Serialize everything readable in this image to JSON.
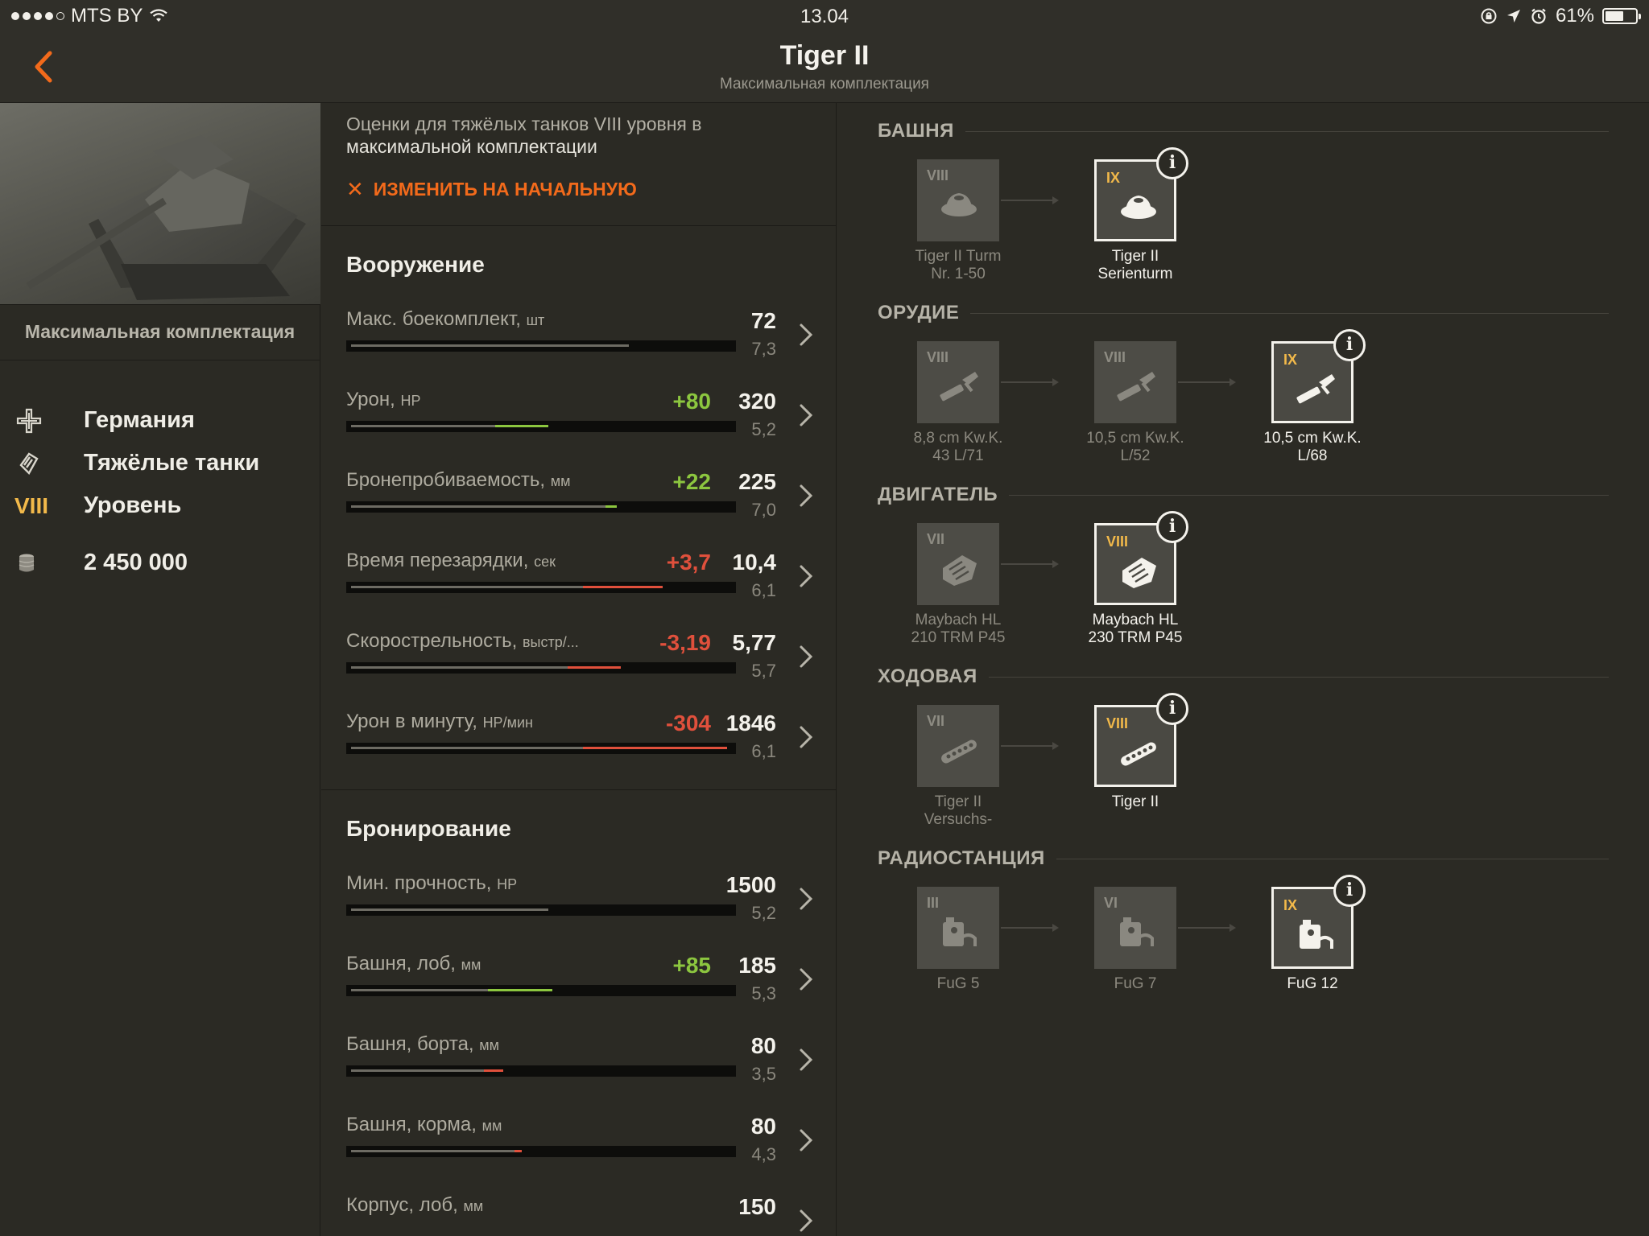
{
  "status": {
    "carrier": "MTS BY",
    "time": "13.04",
    "battery": "61%"
  },
  "nav": {
    "title": "Tiger II",
    "subtitle": "Максимальная комплектация"
  },
  "left": {
    "config_label": "Максимальная комплектация",
    "nation": "Германия",
    "type": "Тяжёлые танки",
    "tier_roman": "VIII",
    "tier_label": "Уровень",
    "price": "2 450 000"
  },
  "mid": {
    "desc_line1": "Оценки для тяжёлых танков VIII уровня в",
    "desc_line2": "максимальной комплектации",
    "reset_label": "ИЗМЕНИТЬ НА НАЧАЛЬНУЮ",
    "armament_title": "Вооружение",
    "armor_title": "Бронирование",
    "armament": [
      {
        "label": "Макс. боекомплект,",
        "unit": "шт",
        "delta": "",
        "value": "72",
        "score": "7,3",
        "base_fraction": 0.73,
        "chg_fraction": 0,
        "chg_color": "none"
      },
      {
        "label": "Урон,",
        "unit": "HP",
        "delta": "+80",
        "value": "320",
        "score": "5,2",
        "base_fraction": 0.38,
        "chg_fraction": 0.52,
        "chg_color": "#8cc63f"
      },
      {
        "label": "Бронепробиваемость,",
        "unit": "мм",
        "delta": "+22",
        "value": "225",
        "score": "7,0",
        "base_fraction": 0.67,
        "chg_fraction": 0.7,
        "chg_color": "#8cc63f"
      },
      {
        "label": "Время перезарядки,",
        "unit": "сек",
        "delta": "+3,7",
        "value": "10,4",
        "score": "6,1",
        "base_fraction": 0.61,
        "chg_fraction": 0.82,
        "chg_color": "#e0503c"
      },
      {
        "label": "Скорострельность,",
        "unit": "выстр/...",
        "delta": "-3,19",
        "value": "5,77",
        "score": "5,7",
        "base_fraction": 0.57,
        "chg_fraction": 0.71,
        "chg_color": "#e0503c"
      },
      {
        "label": "Урон в минуту,",
        "unit": "HP/мин",
        "delta": "-304",
        "value": "1846",
        "score": "6,1",
        "base_fraction": 0.61,
        "chg_fraction": 0.99,
        "chg_color": "#e0503c"
      }
    ],
    "armor": [
      {
        "label": "Мин. прочность,",
        "unit": "HP",
        "delta": "",
        "value": "1500",
        "score": "5,2",
        "base_fraction": 0.52,
        "chg_fraction": 0,
        "chg_color": "none"
      },
      {
        "label": "Башня, лоб,",
        "unit": "мм",
        "delta": "+85",
        "value": "185",
        "score": "5,3",
        "base_fraction": 0.36,
        "chg_fraction": 0.53,
        "chg_color": "#8cc63f"
      },
      {
        "label": "Башня, борта,",
        "unit": "мм",
        "delta": "",
        "value": "80",
        "score": "3,5",
        "base_fraction": 0.35,
        "chg_fraction": 0.4,
        "chg_color": "#e0503c"
      },
      {
        "label": "Башня, корма,",
        "unit": "мм",
        "delta": "",
        "value": "80",
        "score": "4,3",
        "base_fraction": 0.43,
        "chg_fraction": 0.45,
        "chg_color": "#e0503c"
      },
      {
        "label": "Корпус, лоб,",
        "unit": "мм",
        "delta": "",
        "value": "150",
        "score": "",
        "base_fraction": 0,
        "chg_fraction": 0,
        "chg_color": "none"
      }
    ]
  },
  "modules": [
    {
      "title": "БАШНЯ",
      "icon": "turret-icon",
      "items": [
        {
          "tier": "VIII",
          "name1": "Tiger II Turm",
          "name2": "Nr. 1-50",
          "active": false
        },
        {
          "tier": "IX",
          "name1": "Tiger II",
          "name2": "Serienturm",
          "active": true
        }
      ]
    },
    {
      "title": "ОРУДИЕ",
      "icon": "gun-icon",
      "items": [
        {
          "tier": "VIII",
          "name1": "8,8 cm Kw.K.",
          "name2": "43 L/71",
          "active": false
        },
        {
          "tier": "VIII",
          "name1": "10,5 cm Kw.K.",
          "name2": "L/52",
          "active": false
        },
        {
          "tier": "IX",
          "name1": "10,5 cm Kw.K.",
          "name2": "L/68",
          "active": true
        }
      ]
    },
    {
      "title": "ДВИГАТЕЛЬ",
      "icon": "engine-icon",
      "items": [
        {
          "tier": "VII",
          "name1": "Maybach HL",
          "name2": "210 TRM P45",
          "active": false
        },
        {
          "tier": "VIII",
          "name1": "Maybach HL",
          "name2": "230 TRM P45",
          "active": true
        }
      ]
    },
    {
      "title": "ХОДОВАЯ",
      "icon": "track-icon",
      "items": [
        {
          "tier": "VII",
          "name1": "Tiger II",
          "name2": "Versuchs-",
          "active": false
        },
        {
          "tier": "VIII",
          "name1": "Tiger II",
          "name2": "",
          "active": true
        }
      ]
    },
    {
      "title": "РАДИОСТАНЦИЯ",
      "icon": "radio-icon",
      "items": [
        {
          "tier": "III",
          "name1": "FuG 5",
          "name2": "",
          "active": false
        },
        {
          "tier": "VI",
          "name1": "FuG 7",
          "name2": "",
          "active": false
        },
        {
          "tier": "IX",
          "name1": "FuG 12",
          "name2": "",
          "active": true
        }
      ]
    }
  ],
  "info_glyph": "i"
}
